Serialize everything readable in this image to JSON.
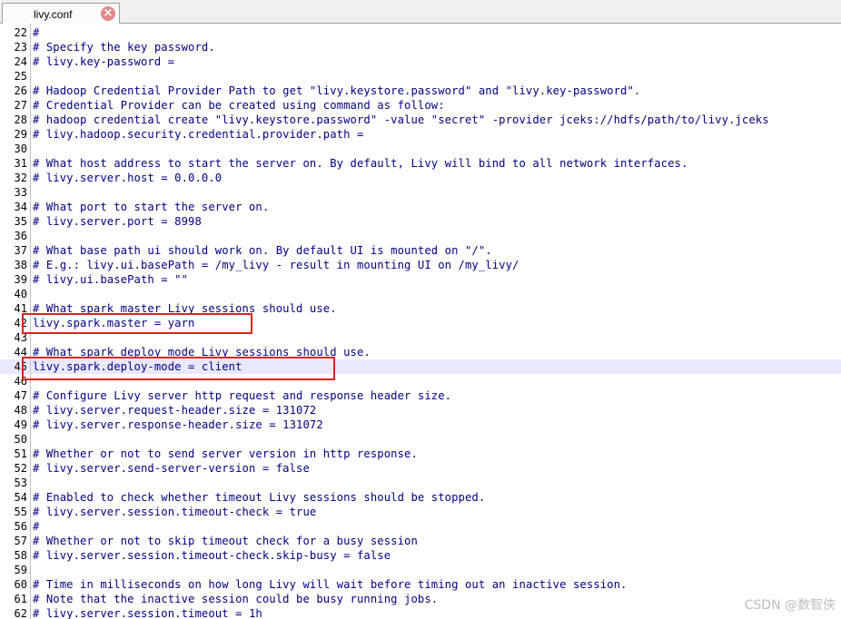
{
  "tab": {
    "label": "livy.conf",
    "close_icon": "close-icon"
  },
  "lines": [
    {
      "n": "22",
      "text": "#"
    },
    {
      "n": "23",
      "text": "# Specify the key password."
    },
    {
      "n": "24",
      "text": "# livy.key-password ="
    },
    {
      "n": "25",
      "text": ""
    },
    {
      "n": "26",
      "text": "# Hadoop Credential Provider Path to get \"livy.keystore.password\" and \"livy.key-password\"."
    },
    {
      "n": "27",
      "text": "# Credential Provider can be created using command as follow:"
    },
    {
      "n": "28",
      "text": "# hadoop credential create \"livy.keystore.password\" -value \"secret\" -provider jceks://hdfs/path/to/livy.jceks"
    },
    {
      "n": "29",
      "text": "# livy.hadoop.security.credential.provider.path ="
    },
    {
      "n": "30",
      "text": ""
    },
    {
      "n": "31",
      "text": "# What host address to start the server on. By default, Livy will bind to all network interfaces."
    },
    {
      "n": "32",
      "text": "# livy.server.host = 0.0.0.0"
    },
    {
      "n": "33",
      "text": ""
    },
    {
      "n": "34",
      "text": "# What port to start the server on."
    },
    {
      "n": "35",
      "text": "# livy.server.port = 8998"
    },
    {
      "n": "36",
      "text": ""
    },
    {
      "n": "37",
      "text": "# What base path ui should work on. By default UI is mounted on \"/\"."
    },
    {
      "n": "38",
      "text": "# E.g.: livy.ui.basePath = /my_livy - result in mounting UI on /my_livy/"
    },
    {
      "n": "39",
      "text": "# livy.ui.basePath = \"\""
    },
    {
      "n": "40",
      "text": ""
    },
    {
      "n": "41",
      "text": "# What spark master Livy sessions should use."
    },
    {
      "n": "42",
      "text": "livy.spark.master = yarn"
    },
    {
      "n": "43",
      "text": ""
    },
    {
      "n": "44",
      "text": "# What spark deploy mode Livy sessions should use."
    },
    {
      "n": "45",
      "text": "livy.spark.deploy-mode = client"
    },
    {
      "n": "46",
      "text": ""
    },
    {
      "n": "47",
      "text": "# Configure Livy server http request and response header size."
    },
    {
      "n": "48",
      "text": "# livy.server.request-header.size = 131072"
    },
    {
      "n": "49",
      "text": "# livy.server.response-header.size = 131072"
    },
    {
      "n": "50",
      "text": ""
    },
    {
      "n": "51",
      "text": "# Whether or not to send server version in http response."
    },
    {
      "n": "52",
      "text": "# livy.server.send-server-version = false"
    },
    {
      "n": "53",
      "text": ""
    },
    {
      "n": "54",
      "text": "# Enabled to check whether timeout Livy sessions should be stopped."
    },
    {
      "n": "55",
      "text": "# livy.server.session.timeout-check = true"
    },
    {
      "n": "56",
      "text": "#"
    },
    {
      "n": "57",
      "text": "# Whether or not to skip timeout check for a busy session"
    },
    {
      "n": "58",
      "text": "# livy.server.session.timeout-check.skip-busy = false"
    },
    {
      "n": "59",
      "text": ""
    },
    {
      "n": "60",
      "text": "# Time in milliseconds on how long Livy will wait before timing out an inactive session."
    },
    {
      "n": "61",
      "text": "# Note that the inactive session could be busy running jobs."
    },
    {
      "n": "62",
      "text": "# livy.server.session.timeout = 1h"
    }
  ],
  "current_line": "45",
  "watermark": "CSDN @数智侠",
  "colors": {
    "text": "#000080",
    "highlight": "#e0201c",
    "current_line_bg": "#e8e8ff"
  }
}
